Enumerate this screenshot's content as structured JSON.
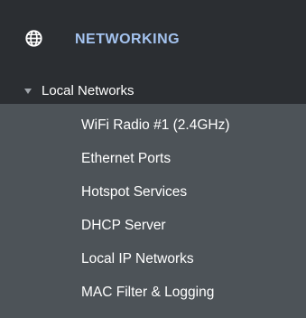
{
  "section": {
    "icon": "globe-icon",
    "title": "NETWORKING",
    "accent_color": "#a4c3ef"
  },
  "group": {
    "label": "Local Networks",
    "expanded": true
  },
  "submenu": {
    "items": [
      {
        "label": "WiFi Radio #1 (2.4GHz)"
      },
      {
        "label": "Ethernet Ports"
      },
      {
        "label": "Hotspot Services"
      },
      {
        "label": "DHCP Server"
      },
      {
        "label": "Local IP Networks"
      },
      {
        "label": "MAC Filter & Logging"
      }
    ]
  }
}
